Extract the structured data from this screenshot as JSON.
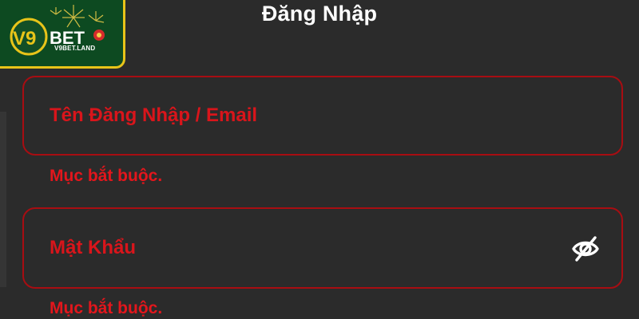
{
  "brand": {
    "logo_text": "V9BET",
    "logo_subtext": "V9BET.LAND",
    "colors": {
      "badge_green": "#0d4a21",
      "badge_gold": "#e8c419"
    }
  },
  "page": {
    "title": "Đăng Nhập",
    "background_color": "#2b2b2b",
    "accent_color": "#d9151b"
  },
  "form": {
    "username": {
      "placeholder": "Tên Đăng Nhập / Email",
      "value": "",
      "error": "Mục bắt buộc."
    },
    "password": {
      "placeholder": "Mật Khẩu",
      "value": "",
      "error": "Mục bắt buộc.",
      "toggle_icon": "eye-slash-icon"
    }
  }
}
